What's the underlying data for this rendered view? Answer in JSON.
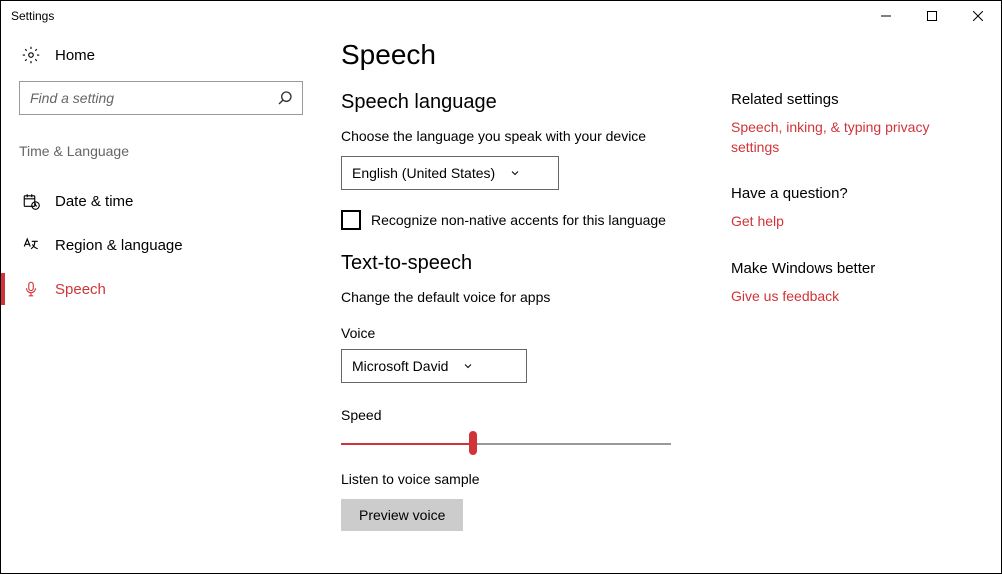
{
  "window": {
    "title": "Settings"
  },
  "sidebar": {
    "home_label": "Home",
    "search_placeholder": "Find a setting",
    "category": "Time & Language",
    "items": [
      {
        "label": "Date & time"
      },
      {
        "label": "Region & language"
      },
      {
        "label": "Speech"
      }
    ]
  },
  "page": {
    "title": "Speech",
    "lang_section": "Speech language",
    "lang_desc": "Choose the language you speak with your device",
    "lang_value": "English (United States)",
    "accent_checkbox": "Recognize non-native accents for this language",
    "tts_section": "Text-to-speech",
    "tts_desc": "Change the default voice for apps",
    "voice_label": "Voice",
    "voice_value": "Microsoft David",
    "speed_label": "Speed",
    "sample_label": "Listen to voice sample",
    "preview_button": "Preview voice"
  },
  "aside": {
    "related_header": "Related settings",
    "related_link": "Speech, inking, & typing privacy settings",
    "question_header": "Have a question?",
    "help_link": "Get help",
    "better_header": "Make Windows better",
    "feedback_link": "Give us feedback"
  }
}
